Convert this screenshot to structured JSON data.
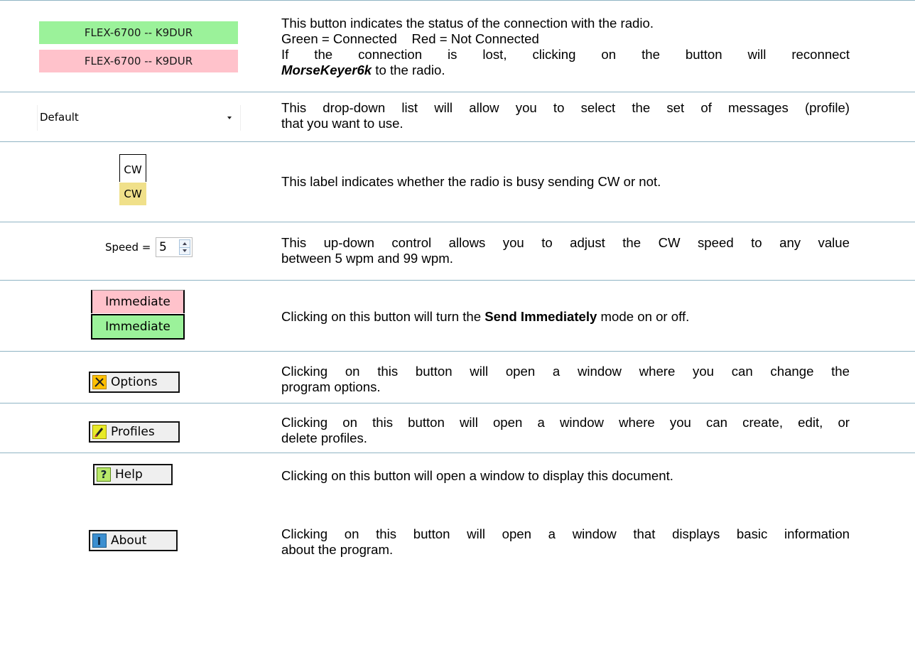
{
  "rows": [
    {
      "ui": {
        "connected_label": "FLEX-6700 -- K9DUR",
        "disconnected_label": "FLEX-6700 -- K9DUR"
      },
      "line1": "This button indicates the status of the connection with the radio.",
      "line2": "Green = Connected    Red = Not Connected",
      "line3": "If the connection is lost, clicking on the button will reconnect",
      "line4_bold": "MorseKeyer6k",
      "line4_rest": " to the radio."
    },
    {
      "ui": {
        "dropdown_value": "Default"
      },
      "line1": "This drop-down list will allow you to select the set of messages (profile)",
      "line2": "that you want to use."
    },
    {
      "ui": {
        "idle_label": "CW",
        "busy_label": "CW"
      },
      "line1": "This label indicates whether the radio is busy sending CW or not."
    },
    {
      "ui": {
        "speed_label": "Speed =",
        "speed_value": "5"
      },
      "line1": "This up-down control allows you to adjust the CW speed to any value",
      "line2": "between 5 wpm and 99 wpm."
    },
    {
      "ui": {
        "off_label": "Immediate",
        "on_label": "Immediate"
      },
      "text_before": "Clicking on this button will turn the ",
      "text_bold": "Send Immediately",
      "text_after": " mode on or off."
    },
    {
      "ui": {
        "button_label": "Options",
        "icon": "tools-icon"
      },
      "line1": "Clicking on this button will open a window where you can change the",
      "line2": "program options."
    },
    {
      "ui": {
        "button_label": "Profiles",
        "icon": "pencil-icon"
      },
      "line1": "Clicking on this button will open a window where you can create, edit, or",
      "line2": "delete profiles."
    },
    {
      "ui": {
        "button_label": "Help",
        "icon": "question-icon"
      },
      "line1": "Clicking on this button will open a window to display this document."
    },
    {
      "ui": {
        "button_label": "About",
        "icon": "info-icon"
      },
      "line1": "Clicking on this button will open a window that displays basic information",
      "line2": "about the program."
    }
  ],
  "colors": {
    "connected": "#9bf29a",
    "not_connected": "#ffc2cb",
    "cw_busy": "#f0e08a",
    "row_divider": "#8fb4c4"
  }
}
